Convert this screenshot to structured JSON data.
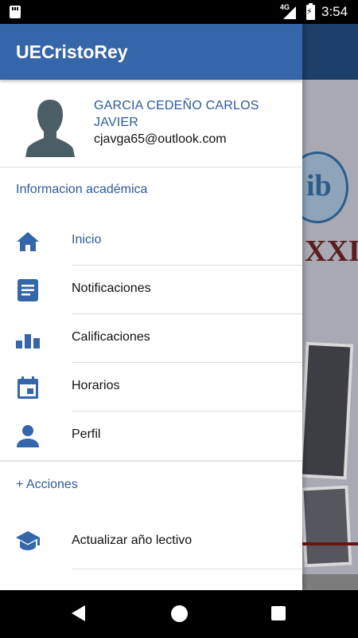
{
  "status_bar": {
    "network": "4G",
    "time": "3:54",
    "icons": [
      "sd-card-icon",
      "signal-icon",
      "battery-charging-icon"
    ]
  },
  "background_app": {
    "poster_text": "XXI"
  },
  "drawer": {
    "app_title": "UECristoRey",
    "user": {
      "name": "GARCIA CEDEÑO CARLOS JAVIER",
      "email": "cjavga65@outlook.com",
      "avatar_icon": "person-silhouette-icon"
    },
    "academic_section_label": "Informacion académica",
    "menu_items": [
      {
        "label": "Inicio",
        "icon": "home-icon",
        "active": true
      },
      {
        "label": "Notificaciones",
        "icon": "document-icon",
        "active": false
      },
      {
        "label": "Calificaciones",
        "icon": "bar-chart-icon",
        "active": false
      },
      {
        "label": "Horarios",
        "icon": "calendar-icon",
        "active": false
      },
      {
        "label": "Perfil",
        "icon": "person-icon",
        "active": false
      }
    ],
    "actions_label": "+ Acciones",
    "action_items": [
      {
        "label": "Actualizar año lectivo",
        "icon": "graduation-cap-icon"
      }
    ]
  },
  "nav_bar": {
    "buttons": [
      "back-icon",
      "home-icon",
      "recents-icon"
    ]
  },
  "colors": {
    "primary": "#3566aa",
    "accent_text": "#2c5a9e",
    "icon": "#3566aa"
  }
}
